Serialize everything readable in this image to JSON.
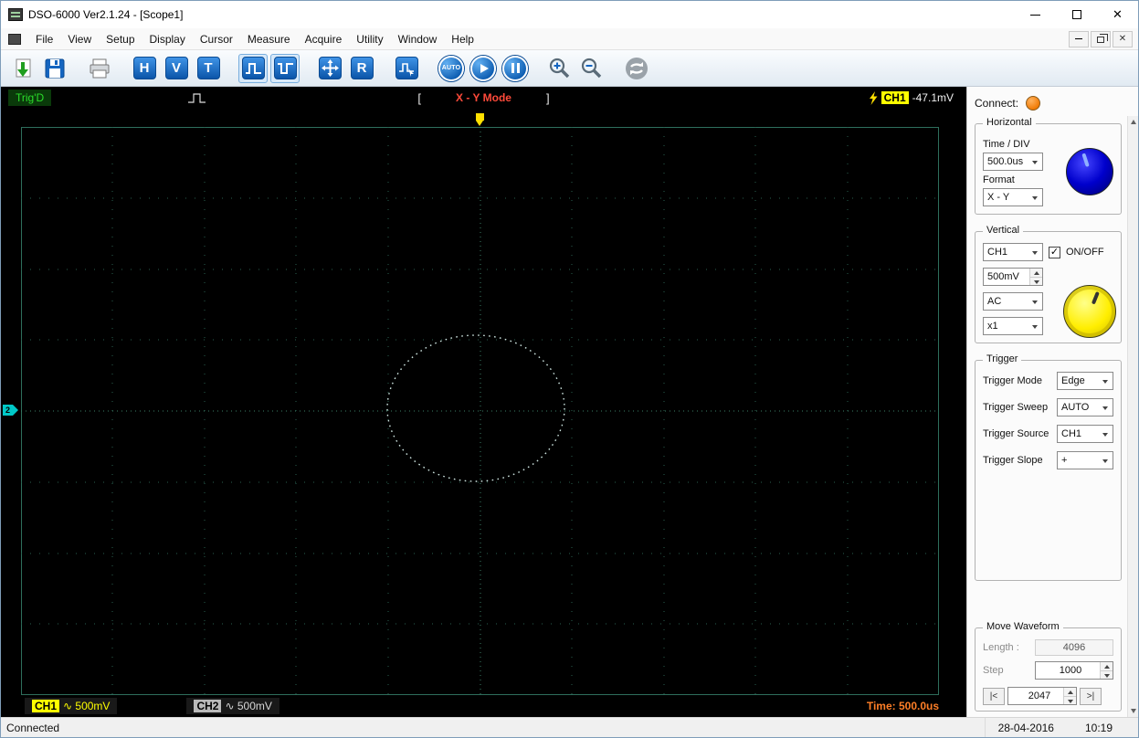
{
  "window": {
    "title": "DSO-6000 Ver2.1.24 - [Scope1]"
  },
  "menu": {
    "items": [
      "File",
      "View",
      "Setup",
      "Display",
      "Cursor",
      "Measure",
      "Acquire",
      "Utility",
      "Window",
      "Help"
    ]
  },
  "toolbar": {
    "h": "H",
    "v": "V",
    "t": "T",
    "r": "R",
    "auto": "AUTO"
  },
  "scope": {
    "trig_status": "Trig'D",
    "mode_left_bracket": "[",
    "mode": "X - Y Mode",
    "mode_right_bracket": "]",
    "trig_ch_badge": "CH1",
    "trig_level": "-47.1mV",
    "ch2_marker": "2",
    "ch1_badge": "CH1",
    "ch1_scale": "∿ 500mV",
    "ch2_badge": "CH2",
    "ch2_scale": "∿ 500mV",
    "time_label": "Time: 500.0us"
  },
  "panel": {
    "connect_label": "Connect:",
    "horizontal": {
      "title": "Horizontal",
      "time_div_label": "Time / DIV",
      "time_div": "500.0us",
      "format_label": "Format",
      "format": "X - Y"
    },
    "vertical": {
      "title": "Vertical",
      "channel": "CH1",
      "onoff": "ON/OFF",
      "volts_div": "500mV",
      "coupling": "AC",
      "probe": "x1"
    },
    "trigger": {
      "title": "Trigger",
      "rows": [
        {
          "label": "Trigger Mode",
          "value": "Edge"
        },
        {
          "label": "Trigger Sweep",
          "value": "AUTO"
        },
        {
          "label": "Trigger Source",
          "value": "CH1"
        },
        {
          "label": "Trigger Slope",
          "value": "+"
        }
      ]
    },
    "move": {
      "title": "Move Waveform",
      "length_label": "Length :",
      "length": "4096",
      "step_label": "Step",
      "step": "1000",
      "go_first": "|<",
      "position": "2047",
      "go_last": ">|"
    }
  },
  "statusbar": {
    "connection": "Connected",
    "date": "28-04-2016",
    "time": "10:19"
  }
}
